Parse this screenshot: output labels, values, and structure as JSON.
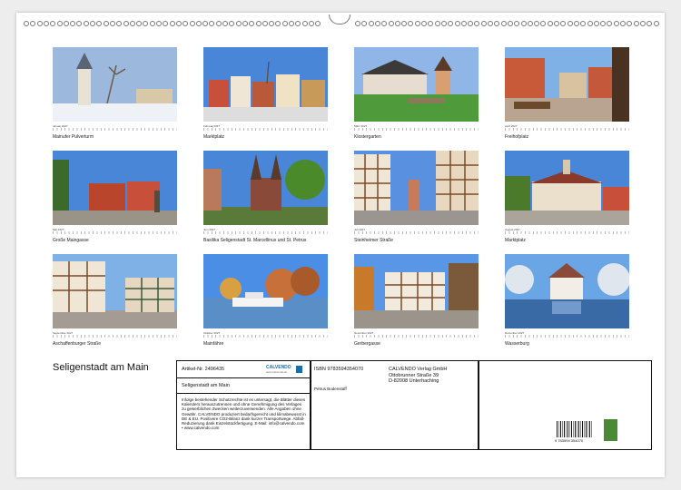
{
  "calendar": {
    "title": "Seligenstadt am Main",
    "months": [
      {
        "label": "Januar 2027",
        "caption": "Mainufer Pulverturm"
      },
      {
        "label": "Februar 2027",
        "caption": "Marktplatz"
      },
      {
        "label": "März 2027",
        "caption": "Klostergarten"
      },
      {
        "label": "April 2027",
        "caption": "Freihofplatz"
      },
      {
        "label": "Mai 2027",
        "caption": "Große Maingasse"
      },
      {
        "label": "Juni 2027",
        "caption": "Basilika Seligenstadt St. Marcellinus und St. Petrus"
      },
      {
        "label": "Juli 2027",
        "caption": "Steinheimer Straße"
      },
      {
        "label": "August 2027",
        "caption": "Marktplatz"
      },
      {
        "label": "September 2027",
        "caption": "Aschaffenburger Straße"
      },
      {
        "label": "Oktober 2027",
        "caption": "Mainfähre"
      },
      {
        "label": "November 2027",
        "caption": "Gerbergasse"
      },
      {
        "label": "Dezember 2027",
        "caption": "Wasserburg"
      }
    ]
  },
  "info": {
    "article": "Artikel-Nr. 2496435",
    "logo_text": "CALVENDO",
    "logo_sub": "www.calvendo.de",
    "title": "Seligenstadt am Main",
    "isbn": "ISBN 9783594354070",
    "publisher_name": "CALVENDO Verlag GmbH",
    "publisher_street": "Ottobrunner Straße 39",
    "publisher_city": "D-82008 Unterhaching",
    "author": "Petrus Bodenstaff",
    "legal": "Infolge bestehender Schutzrechte ist es untersagt, die Blätter dieses Kalenders herauszutrennen und ohne Genehmigung des Verlages zu gewerblichen Zwecken weiterzuverwenden. Alle Angaben ohne Gewähr. CALVENDO produziert bedarfsgerecht und klimabewusst in DE & EU. Positivere CO2-Bilanz dank kurzer Transportwege. Abfall-Reduzierung dank Einzelstückfertigung. E-Mail: info@calvendo.com • www.calvendo.com",
    "barcode_number": "9 783594 354070"
  },
  "colors": {
    "sky": "#4a86d8",
    "grass": "#4f9a3a",
    "timber": "#7a4a2a",
    "plaster": "#efe6d6"
  }
}
